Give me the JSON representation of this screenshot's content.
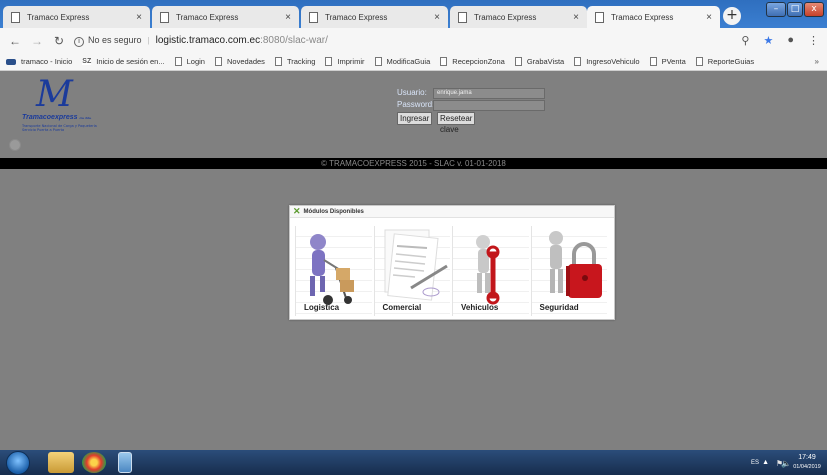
{
  "browser": {
    "tabs": [
      {
        "label": "Tramaco Express",
        "close": "×"
      },
      {
        "label": "Tramaco Express",
        "close": "×"
      },
      {
        "label": "Tramaco Express",
        "close": "×"
      },
      {
        "label": "Tramaco Express",
        "close": "×"
      },
      {
        "label": "Tramaco Express",
        "close": "×"
      }
    ],
    "active_tab_index": 4,
    "new_tab": "+",
    "window_controls": {
      "minimize": "–",
      "maximize": "□",
      "close": "x"
    },
    "address": {
      "security_text": "No es seguro",
      "host": "logistic.tramaco.com.ec",
      "path": ":8080/slac-war/"
    },
    "bookmarks": [
      "tramaco - Inicio",
      "Inicio de sesión en...",
      "Login",
      "Novedades",
      "Tracking",
      "Imprimir",
      "ModificaGuia",
      "RecepcionZona",
      "GrabaVista",
      "IngresoVehiculo",
      "PVenta",
      "ReporteGuias"
    ],
    "bookmarks_more": "»"
  },
  "page": {
    "logo": {
      "mark": "M",
      "brand": "Tramacoexpress",
      "brand_suffix": "cia. ltda.",
      "tagline": "Transporte Nacional de Carga y Paquetería\nServicio Puerta a Puerta"
    },
    "login": {
      "user_label": "Usuario:",
      "user_value": "enrique.jama",
      "password_label": "Password:",
      "password_value": "",
      "login_button": "Ingresar",
      "reset_button": "Resetear clave"
    },
    "copyright": "© TRAMACOEXPRESS 2015 - SLAC v. 01-01-2018",
    "modules": {
      "title": "Módulos Disponibles",
      "items": [
        {
          "label": "Logistica",
          "icon": "forklift-person-icon"
        },
        {
          "label": "Comercial",
          "icon": "contract-pen-icon"
        },
        {
          "label": "Vehiculos",
          "icon": "wrench-person-icon"
        },
        {
          "label": "Seguridad",
          "icon": "padlock-person-icon"
        }
      ]
    }
  },
  "taskbar": {
    "lang": "ES",
    "time": "17:49",
    "date": "01/04/2019"
  }
}
